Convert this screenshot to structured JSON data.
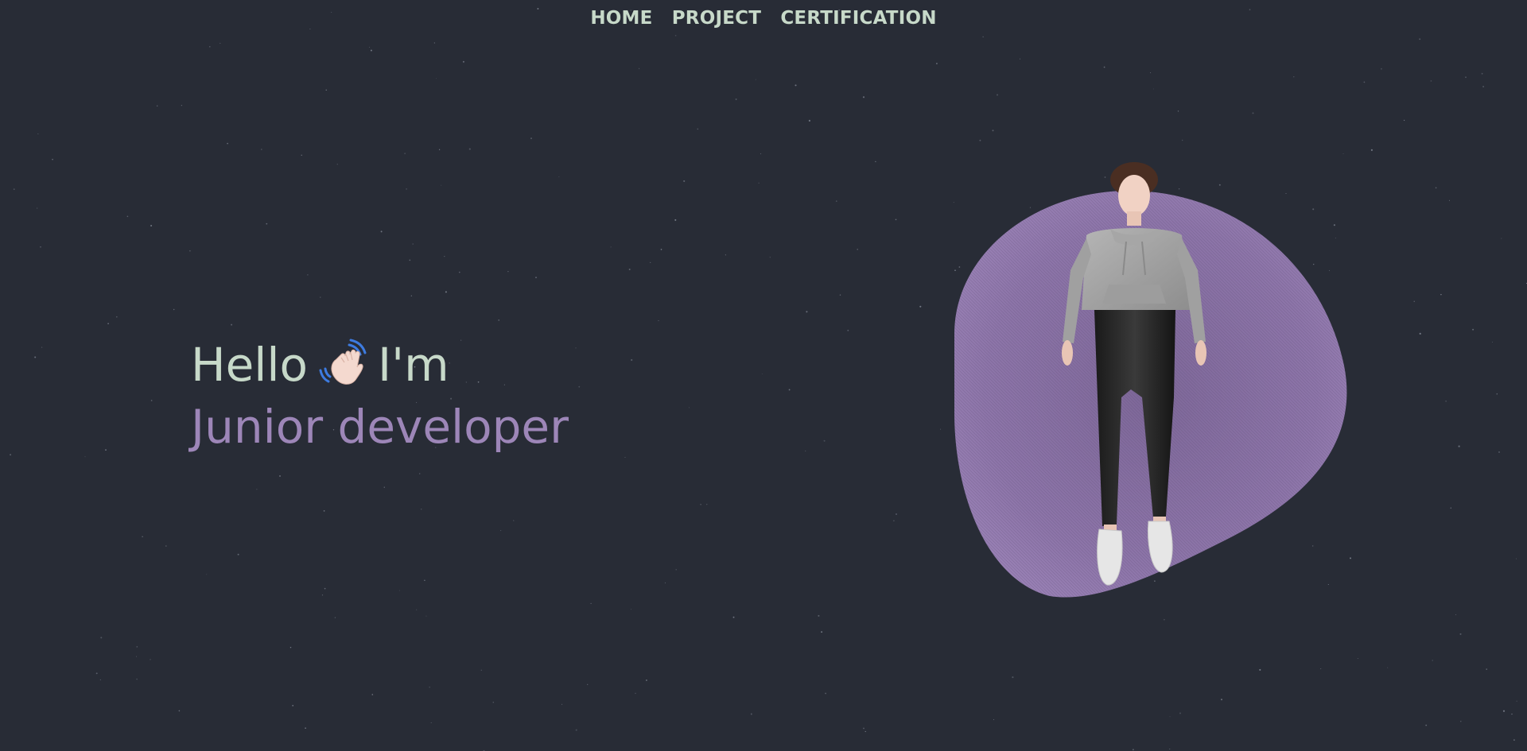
{
  "nav": {
    "items": [
      {
        "label": "HOME"
      },
      {
        "label": "PROJECT"
      },
      {
        "label": "CERTIFICATION"
      }
    ]
  },
  "hero": {
    "hello": "Hello",
    "im": "I'm",
    "role": "Junior developer",
    "wave_icon": "waving-hand-icon"
  },
  "colors": {
    "background": "#282c36",
    "text_primary": "#c7d9c9",
    "accent": "#9d86b8",
    "blob": "#8f76aa"
  }
}
